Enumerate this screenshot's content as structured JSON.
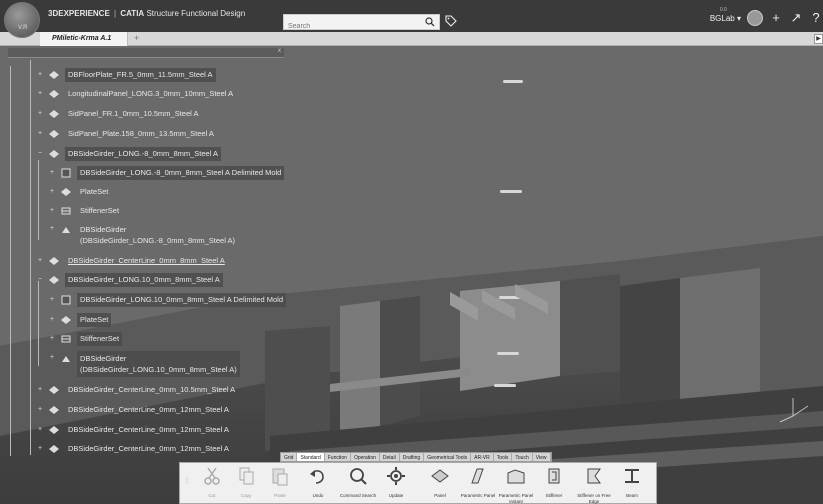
{
  "app": {
    "brand_prefix": "3DEXPERIENCE",
    "brand_sep": "|",
    "brand_product": "CATIA",
    "brand_app": "Structure Functional Design",
    "compass_version": "V.R"
  },
  "search": {
    "placeholder": "Search"
  },
  "topright": {
    "tenant": "BGLab",
    "tenant_sup": "0.0",
    "add": "+",
    "share": "↗"
  },
  "tabs": [
    {
      "label": "PMiletic-Krma A.1"
    }
  ],
  "tab_add": "+",
  "tree": {
    "close": "x",
    "nodes": [
      {
        "label": "DBFloorPlate_FR.5_0mm_11.5mm_Steel A"
      },
      {
        "label": "LongitudinalPanel_LONG.3_0mm_10mm_Steel A"
      },
      {
        "label": "SidPanel_FR.1_0mm_10.5mm_Steel A"
      },
      {
        "label": "SidPanel_Plate.158_0mm_13.5mm_Steel A"
      },
      {
        "label": "DBSideGirder_LONG.-8_0mm_8mm_Steel A"
      },
      {
        "label": "DBSideGirder_LONG.-8_0mm_8mm_Steel A Delimited Mold"
      },
      {
        "label": "PlateSet"
      },
      {
        "label": "StiffenerSet"
      },
      {
        "label": "DBSideGirder",
        "label2": "(DBSideGirder_LONG.-8_0mm_8mm_Steel A)"
      },
      {
        "label": "DBSideGirder_CenterLine_0mm_8mm_Steel A"
      },
      {
        "label": "DBSideGirder_LONG.10_0mm_8mm_Steel A"
      },
      {
        "label": "DBSideGirder_LONG.10_0mm_8mm_Steel A Delimited Mold"
      },
      {
        "label": "PlateSet"
      },
      {
        "label": "StiffenerSet"
      },
      {
        "label": "DBSideGirder",
        "label2": "(DBSideGirder_LONG.10_0mm_8mm_Steel A)"
      },
      {
        "label": "DBSideGirder_CenterLine_0mm_10.5mm_Steel A"
      },
      {
        "label": "DBSideGirder_CenterLine_0mm_12mm_Steel A"
      },
      {
        "label": "DBSideGirder_CenterLine_0mm_12mm_Steel A"
      },
      {
        "label": "DBSideGirder_CenterLine_0mm_12mm_Steel A"
      }
    ]
  },
  "toolbar": {
    "tabs": [
      "Grid",
      "Standard",
      "Function",
      "Operation",
      "Detail",
      "Drafting",
      "Geometrical Tools",
      "AR-VR",
      "Tools",
      "Touch",
      "View"
    ],
    "active_tab": "Standard",
    "commands": [
      {
        "label": "Cut"
      },
      {
        "label": "Copy"
      },
      {
        "label": "Paste"
      },
      {
        "label": "Undo"
      },
      {
        "label": "Command Search"
      },
      {
        "label": "Update"
      },
      {
        "label": "Panel"
      },
      {
        "label": "Parametric Panel"
      },
      {
        "label": "Parametric Panel Instant"
      },
      {
        "label": "Stiffener"
      },
      {
        "label": "Stiffener on Free Edge"
      },
      {
        "label": "Beam"
      }
    ]
  }
}
